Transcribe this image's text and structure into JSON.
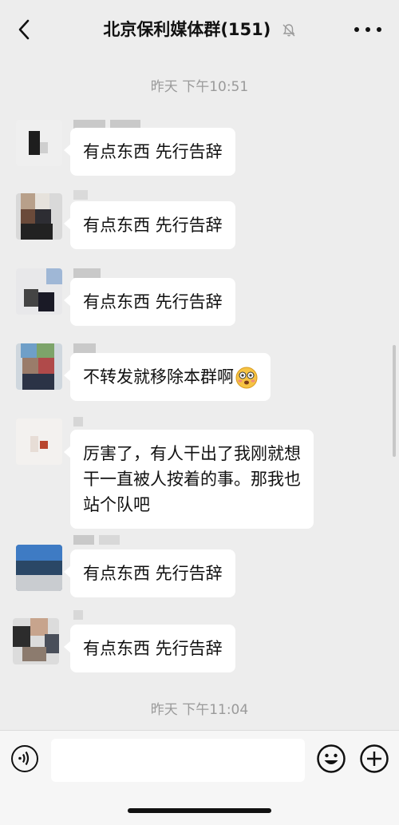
{
  "header": {
    "title": "北京保利媒体群(151)",
    "back_icon": "chevron-left-icon",
    "mute_icon": "bell-off-icon",
    "more_icon": "more-dots-icon"
  },
  "timestamps": {
    "top": "昨天 下午10:51",
    "bottom": "昨天 下午11:04"
  },
  "messages": [
    {
      "text": "有点东西 先行告辞"
    },
    {
      "text": "有点东西 先行告辞"
    },
    {
      "text": "有点东西 先行告辞"
    },
    {
      "text": "不转发就移除本群啊",
      "emoji": "flushed-face-icon"
    },
    {
      "line1": "厉害了，有人干出了我刚就想",
      "line2": "干一直被人按着的事。那我也",
      "line3": "站个队吧"
    },
    {
      "text": "有点东西 先行告辞"
    },
    {
      "text": "有点东西 先行告辞"
    }
  ],
  "composer": {
    "voice_icon": "voice-icon",
    "emoji_icon": "emoji-icon",
    "plus_icon": "plus-icon"
  },
  "colors": {
    "background": "#ededed",
    "bubble": "#ffffff",
    "timestamp": "#9a9a9a"
  }
}
